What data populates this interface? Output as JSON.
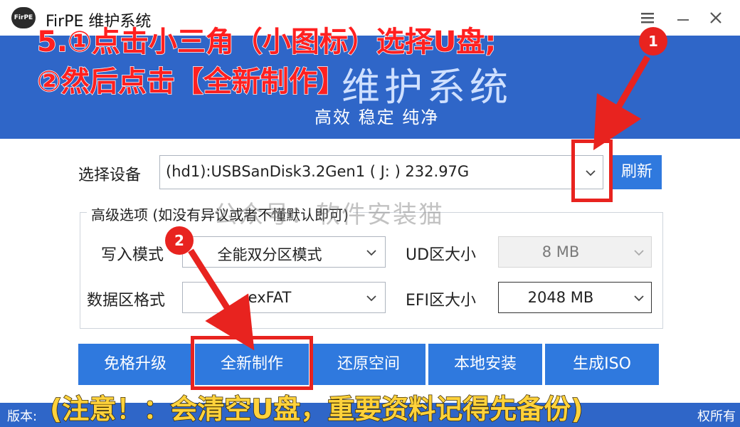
{
  "window": {
    "logo_text": "FirPE",
    "title": "FirPE 维护系统",
    "menu_icon": "hamburger-icon",
    "minimize_icon": "minimize-icon",
    "close_icon": "close-icon"
  },
  "banner": {
    "brand": "维护系统",
    "tagline": "高效 稳定 纯净"
  },
  "device": {
    "label": "选择设备",
    "value": "(hd1):USBSanDisk3.2Gen1 ( J: ) 232.97G",
    "refresh_label": "刷新"
  },
  "advanced": {
    "title": "高级选项 (如没有异议或者不懂默认即可)",
    "write_mode_label": "写入模式",
    "write_mode_value": "全能双分区模式",
    "data_format_label": "数据区格式",
    "data_format_value": "exFAT",
    "ud_size_label": "UD区大小",
    "ud_size_value": "8 MB",
    "efi_size_label": "EFI区大小",
    "efi_size_value": "2048 MB"
  },
  "actions": {
    "upgrade": "免格升级",
    "new_make": "全新制作",
    "restore_space": "还原空间",
    "local_install": "本地安装",
    "generate_iso": "生成ISO"
  },
  "status": {
    "version_label": "版本:",
    "rights": "权所有"
  },
  "overlay": {
    "step_line1": "5.①点击小三角（小图标）选择U盘;",
    "step_line2": "②然后点击【全新制作】",
    "badge1": "1",
    "badge2": "2",
    "watermark": "公众号：软件安装猫",
    "note": "(注意！：会清空U盘，重要资料记得先备份)"
  },
  "colors": {
    "banner": "#2f66c8",
    "button": "#2f79de",
    "annotation_red": "#e8231f",
    "note_yellow": "#ffd23b"
  }
}
